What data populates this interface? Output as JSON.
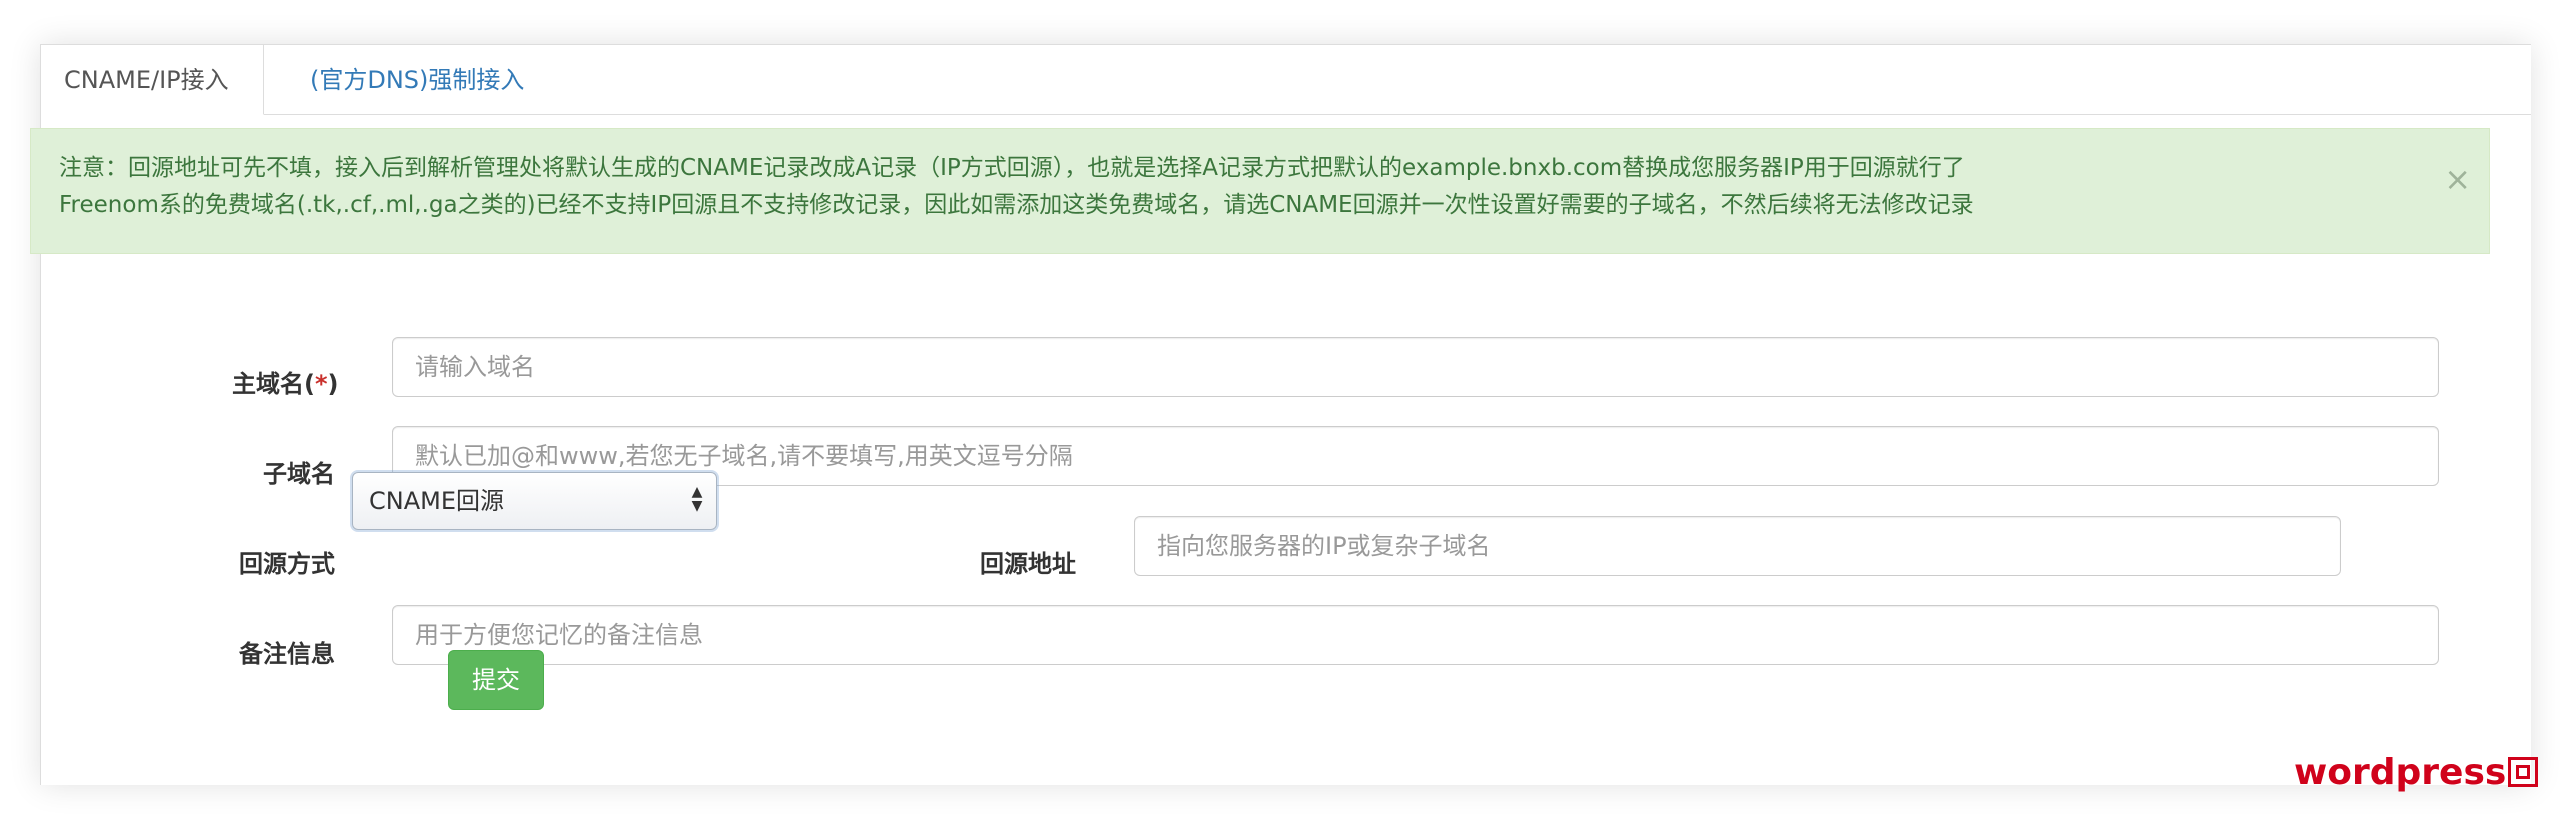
{
  "tabs": [
    {
      "label": "CNAME/IP接入",
      "active": true
    },
    {
      "label": "(官方DNS)强制接入",
      "active": false
    }
  ],
  "alert": {
    "line1": "注意：回源地址可先不填，接入后到解析管理处将默认生成的CNAME记录改成A记录（IP方式回源），也就是选择A记录方式把默认的example.bnxb.com替换成您服务器IP用于回源就行了",
    "line2": "Freenom系的免费域名(.tk,.cf,.ml,.ga之类的)已经不支持IP回源且不支持修改记录，因此如需添加这类免费域名，请选CNAME回源并一次性设置好需要的子域名，不然后续将无法修改记录",
    "close": "×"
  },
  "form": {
    "main_domain": {
      "label": "主域名",
      "required_prefix": "(",
      "required_mark": "*",
      "required_suffix": ")",
      "placeholder": "请输入域名",
      "value": ""
    },
    "subdomain": {
      "label": "子域名",
      "placeholder": "默认已加@和www,若您无子域名,请不要填写,用英文逗号分隔",
      "value": ""
    },
    "origin_method": {
      "label": "回源方式",
      "selected": "CNAME回源"
    },
    "origin_address": {
      "label": "回源地址",
      "placeholder": "指向您服务器的IP或复杂子域名",
      "value": ""
    },
    "note": {
      "label": "备注信息",
      "placeholder": "用于方便您记忆的备注信息",
      "value": ""
    },
    "submit": "提交"
  },
  "watermark": "wordpress",
  "colors": {
    "link": "#337ab7",
    "alert_bg": "#dff0d8",
    "alert_text": "#3c763d",
    "button": "#5cb85c",
    "required": "#c9302c",
    "watermark": "#d0021b"
  }
}
